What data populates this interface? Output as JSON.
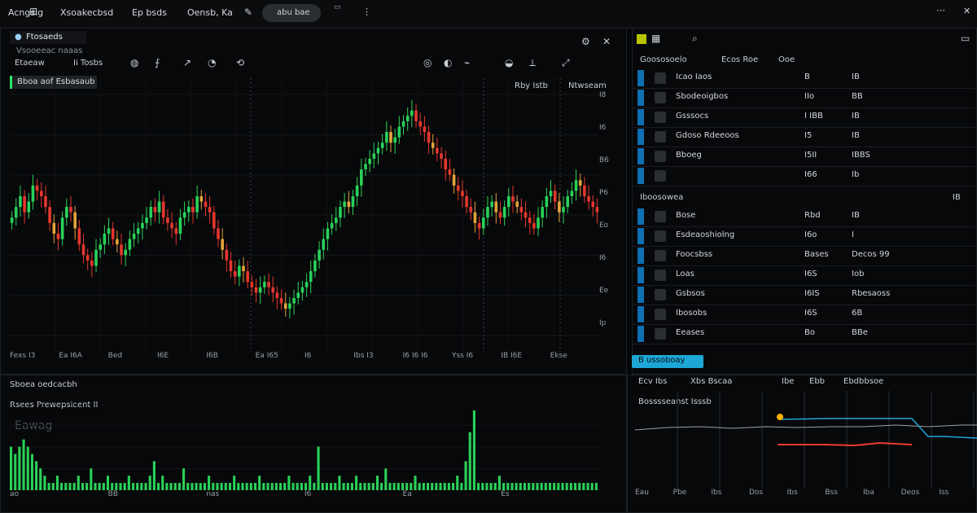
{
  "app": {
    "brand": "Acngsig",
    "menu": [
      "Xsoakecbsd",
      "Ep bsds",
      "Oensb, Ka"
    ],
    "pill_label": "abu bae"
  },
  "chart_panel": {
    "symbol_tag": "Ftosaeds",
    "subtitle": "Vsooeeac naaas",
    "interval_label": "Etaeaw",
    "interval_value": "Ii Tosbs",
    "indicator_tag": "Bboa aof Esbasaub",
    "top_right_label_1": "Rby Istb",
    "top_right_label_2": "Ntwseam",
    "bottom_ticks": [
      "Fexs I3",
      "Ea I6A",
      "Bed",
      "I6E",
      "I6B",
      "Ea I65",
      "I6",
      "Ibs I3",
      "I6 I6 I6",
      "Yss I6",
      "IB I6E",
      "Ekse"
    ],
    "right_ticks": [
      "I8",
      "I6",
      "B6",
      "P6",
      "Eo",
      "I6",
      "Ee",
      "Ip"
    ]
  },
  "chart_data": {
    "type": "line",
    "subtype": "candlestick",
    "x_count": 140,
    "close": [
      22,
      24,
      26,
      23,
      25,
      28,
      27,
      26,
      24,
      21,
      19,
      18,
      22,
      24,
      23,
      20,
      17,
      15,
      14,
      13,
      16,
      17,
      19,
      20,
      18,
      17,
      15,
      16,
      18,
      19,
      20,
      21,
      22,
      24,
      23,
      25,
      22,
      21,
      20,
      19,
      22,
      23,
      24,
      23,
      26,
      25,
      24,
      23,
      20,
      18,
      16,
      14,
      12,
      11,
      13,
      12,
      10,
      9,
      8,
      9,
      10,
      9,
      8,
      7,
      6,
      5,
      6,
      7,
      8,
      9,
      10,
      12,
      14,
      16,
      18,
      20,
      21,
      22,
      24,
      25,
      24,
      26,
      28,
      31,
      32,
      33,
      34,
      35,
      36,
      38,
      36,
      37,
      39,
      40,
      41,
      42,
      40,
      39,
      38,
      36,
      35,
      34,
      33,
      31,
      30,
      28,
      27,
      26,
      24,
      23,
      21,
      20,
      22,
      24,
      25,
      23,
      22,
      24,
      26,
      25,
      24,
      23,
      22,
      21,
      20,
      22,
      24,
      26,
      27,
      25,
      23,
      24,
      26,
      27,
      29,
      28,
      26,
      25,
      24,
      23
    ],
    "ylim": [
      0,
      45
    ],
    "grid": true
  },
  "volume_panel": {
    "title": "Sboea oedcacbh",
    "subtitle": "Rsees Prewepsicent II",
    "left_label": "Eawag",
    "ticks": [
      "ao",
      "BB",
      "nas",
      "I6",
      "Ea",
      "Es"
    ],
    "values": [
      6,
      5,
      6,
      7,
      6,
      5,
      4,
      3,
      2,
      1,
      1,
      2,
      1,
      1,
      1,
      1,
      2,
      1,
      1,
      3,
      1,
      1,
      1,
      2,
      1,
      1,
      1,
      1,
      2,
      1,
      1,
      1,
      1,
      2,
      4,
      1,
      2,
      1,
      1,
      1,
      1,
      3,
      1,
      1,
      1,
      1,
      1,
      2,
      1,
      1,
      1,
      1,
      1,
      2,
      1,
      1,
      1,
      1,
      1,
      2,
      1,
      1,
      1,
      1,
      1,
      1,
      2,
      1,
      1,
      1,
      1,
      2,
      1,
      6,
      1,
      1,
      1,
      1,
      2,
      1,
      1,
      1,
      2,
      1,
      1,
      1,
      1,
      2,
      1,
      3,
      1,
      1,
      1,
      1,
      1,
      1,
      2,
      1,
      1,
      1,
      1,
      1,
      1,
      1,
      1,
      1,
      2,
      1,
      4,
      8,
      11,
      1,
      1,
      1,
      1,
      1,
      2,
      1,
      1,
      1,
      1,
      1,
      1,
      1,
      1,
      1,
      1,
      1,
      1,
      1,
      1,
      1,
      1,
      1,
      1,
      1,
      1,
      1,
      1,
      1
    ]
  },
  "watchlist": {
    "header_cols": [
      "Goososoelo",
      "Ecos Roe",
      "Ooe"
    ],
    "rows": [
      {
        "name": "Icao Iaos",
        "v1": "B",
        "v2": "IB"
      },
      {
        "name": "Sbodeoigbos",
        "v1": "IIo",
        "v2": "BB"
      },
      {
        "name": "Gsssocs",
        "v1": "I IBB",
        "v2": "IB"
      },
      {
        "name": "Gdoso  Rdeeoos",
        "v1": "I5",
        "v2": "IB"
      },
      {
        "name": "Bboeg",
        "v1": "I5II",
        "v2": "IBBS"
      },
      {
        "name": "",
        "v1": "I66",
        "v2": "Ib"
      }
    ],
    "section2_title": "Iboosowea",
    "section2_right": "IB",
    "rows2": [
      {
        "name": "Bose",
        "v1": "Rbd",
        "v2": "IB"
      },
      {
        "name": "Esdeaoshiolng",
        "v1": "I6o",
        "v2": "I"
      },
      {
        "name": "Foocsbss",
        "v1": "Bases",
        "v2": "Decos 99"
      },
      {
        "name": "Loas",
        "v1": "I6S",
        "v2": "Iob"
      },
      {
        "name": "Gsbsos",
        "v1": "I6IS",
        "v2": "Rbesaoss"
      },
      {
        "name": "Ibosobs",
        "v1": "I6S",
        "v2": "6B"
      },
      {
        "name": "Eeases",
        "v1": "Bo",
        "v2": "BBe"
      }
    ],
    "action_button": "B ussoboay"
  },
  "indicator_panel": {
    "tabs": [
      "Ecv Ibs",
      "Xbs Bscaa",
      "Ibe",
      "Ebb",
      "Ebdbbsoe"
    ],
    "title": "Bosssseanst Isssb",
    "bottom_ticks": [
      "Eau",
      "Pbe",
      "Ibs",
      "Dos",
      "Ibs",
      "Bss",
      "Iba",
      "Deos",
      "Iss"
    ]
  },
  "colors": {
    "up": "#23d160",
    "down": "#ef3b2f",
    "accent_blue": "#1ea7d6"
  },
  "icons": [
    "logo-icon",
    "settings-icon",
    "close-icon",
    "search-icon",
    "bell-icon"
  ]
}
